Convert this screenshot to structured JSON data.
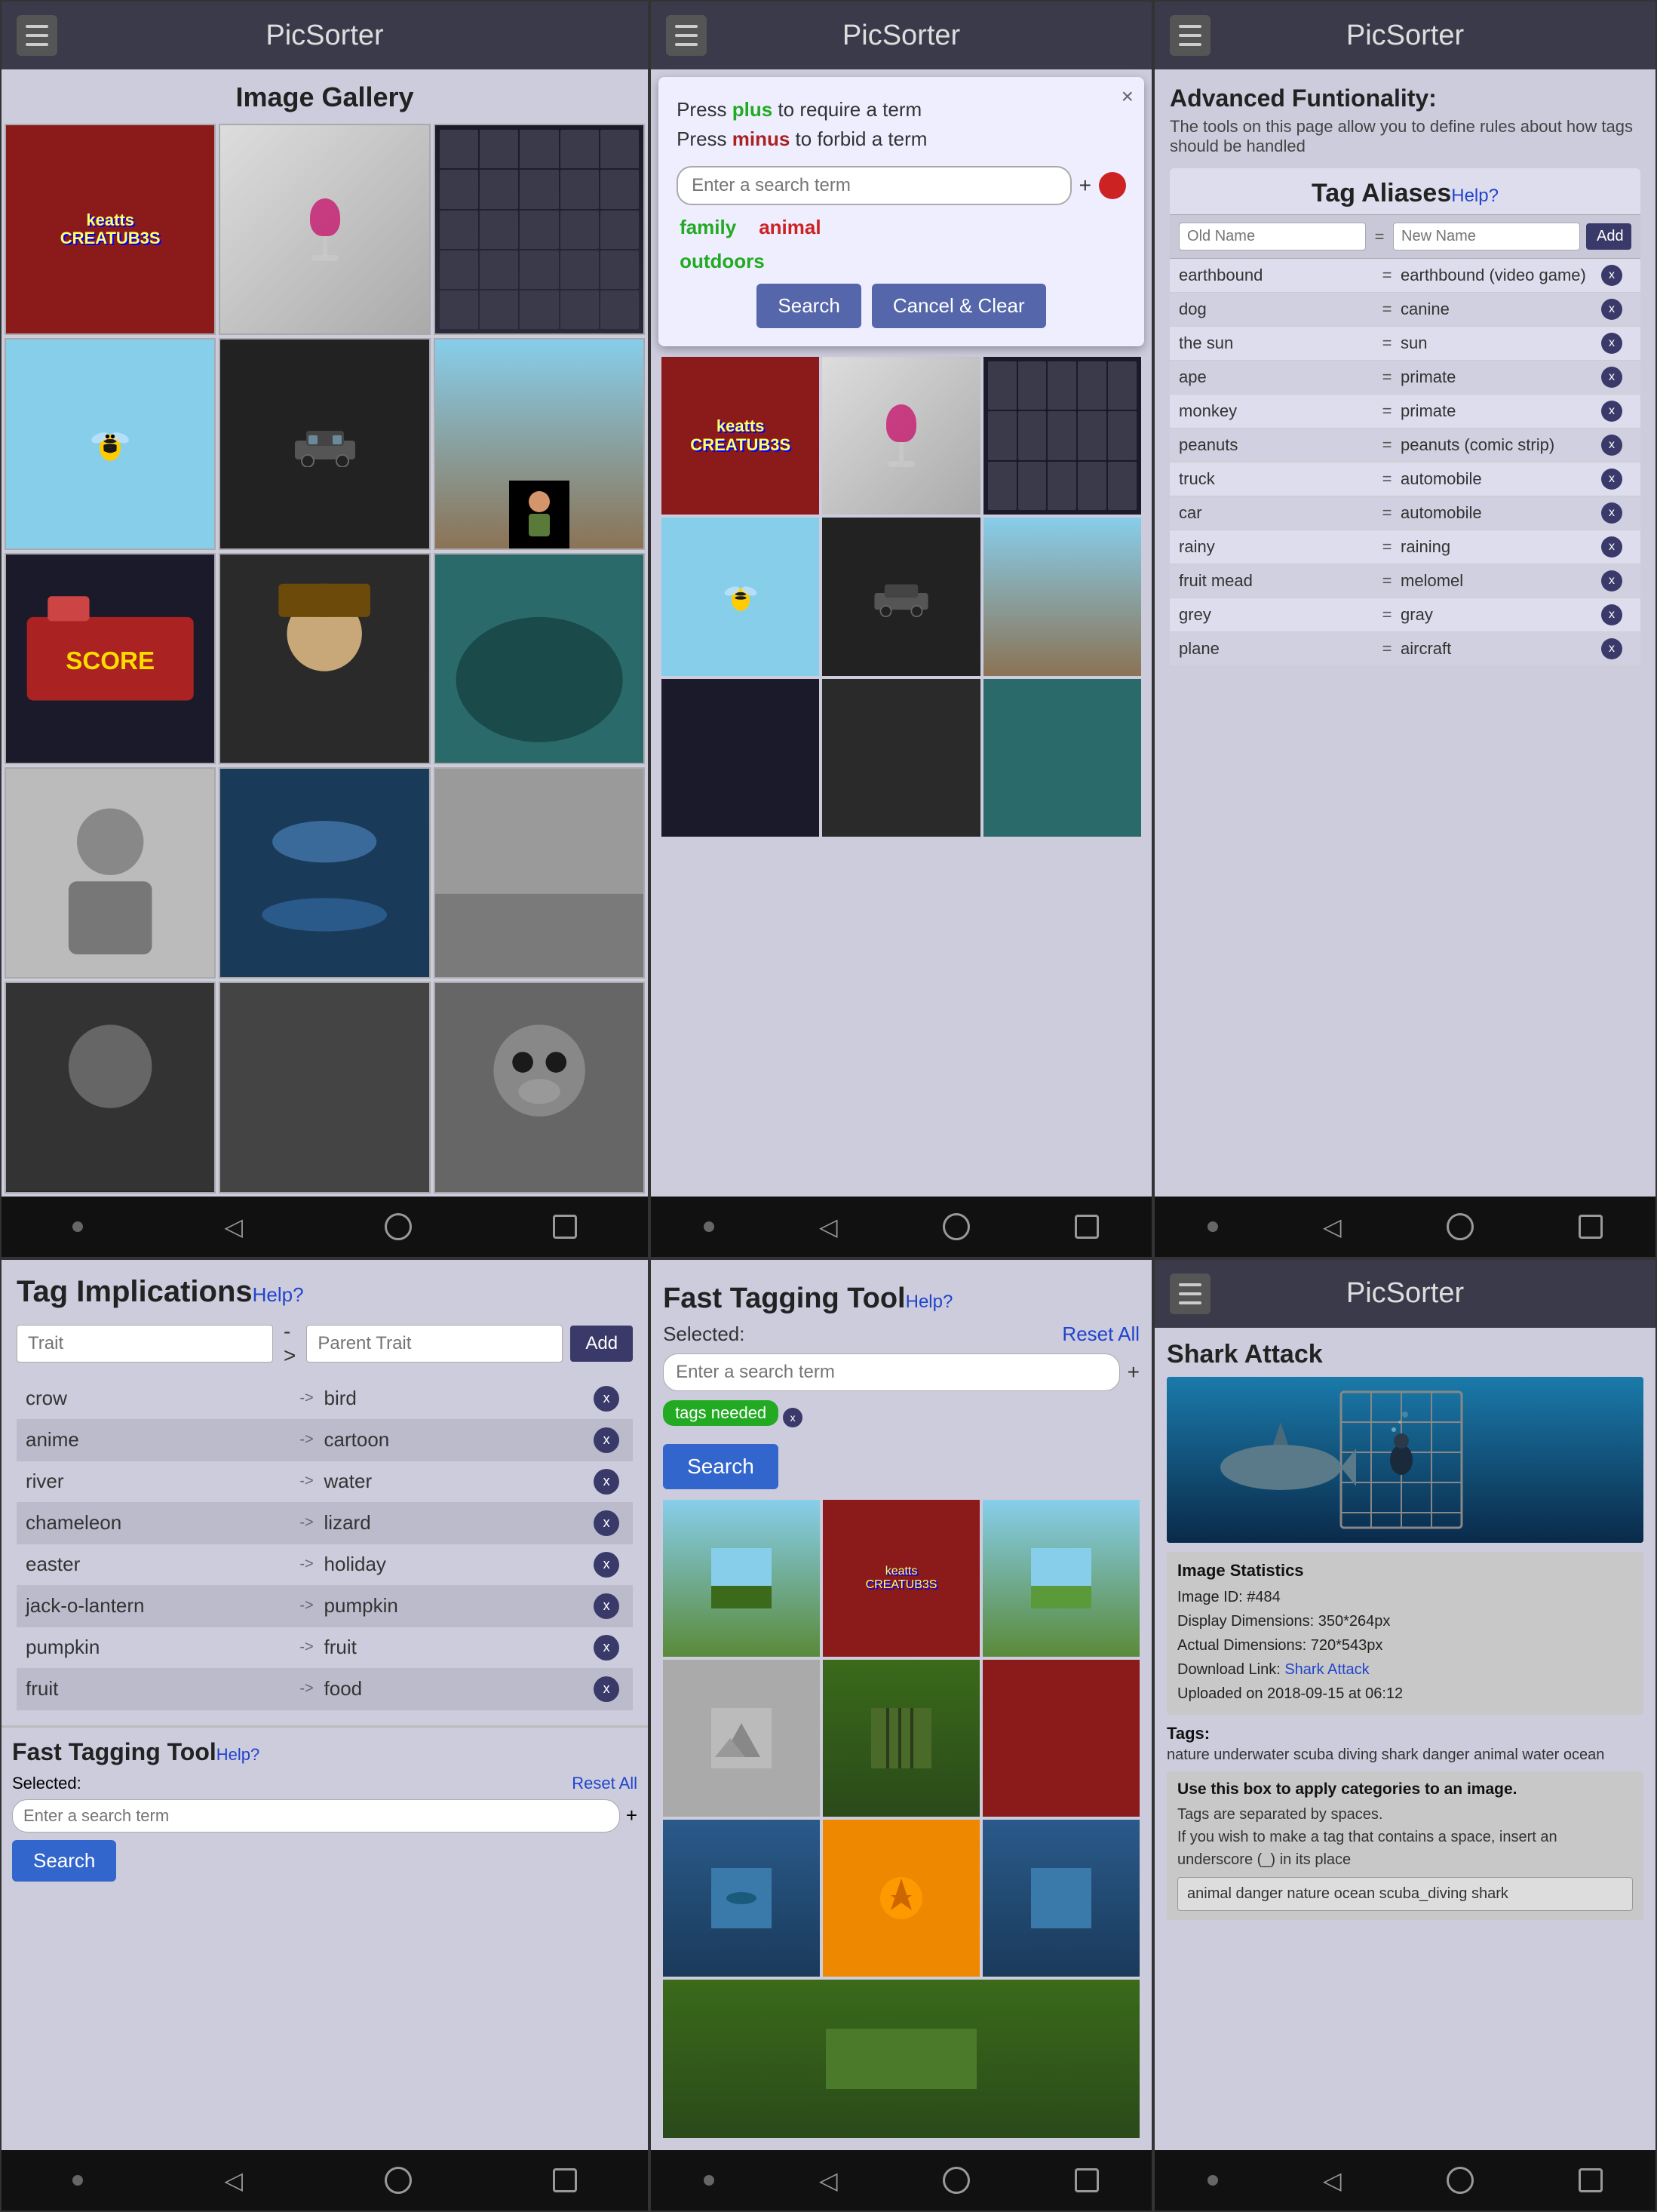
{
  "panels": {
    "panel1": {
      "header": {
        "title": "PicSorter"
      },
      "gallery": {
        "title": "Image Gallery",
        "images": [
          "creature",
          "wine",
          "keyboard",
          "bee",
          "car",
          "person-outdoor",
          "game",
          "man-hat",
          "teal",
          "oldman",
          "water-barrel",
          "crowd",
          "ghost",
          "pale2",
          "lemur"
        ]
      }
    },
    "panel2": {
      "header": {
        "title": "PicSorter"
      },
      "modal": {
        "instruction1": "Press plus to require a term",
        "instruction1_plus": "plus",
        "instruction2": "Press minus to forbid a term",
        "instruction2_minus": "minus",
        "input_placeholder": "Enter a search term",
        "tags": [
          "family",
          "outdoors",
          "animal"
        ],
        "tag_colors": [
          "green",
          "green",
          "red"
        ],
        "search_btn": "Search",
        "cancel_btn": "Cancel & Clear"
      }
    },
    "panel3": {
      "header": {
        "title": "PicSorter"
      },
      "advanced": {
        "title": "Advanced Funtionality:",
        "subtitle": "The tools on this page allow you to define rules about how tags should be handled",
        "aliases": {
          "title": "Tag Aliases",
          "help": "Help?",
          "col_old": "Old Name",
          "col_eq": "=",
          "col_new": "New Name",
          "add_btn": "Add",
          "rows": [
            {
              "old": "earthbound",
              "new": "earthbound (video game)"
            },
            {
              "old": "dog",
              "new": "canine"
            },
            {
              "old": "the sun",
              "new": "sun"
            },
            {
              "old": "ape",
              "new": "primate"
            },
            {
              "old": "monkey",
              "new": "primate"
            },
            {
              "old": "peanuts",
              "new": "peanuts (comic strip)"
            },
            {
              "old": "truck",
              "new": "automobile"
            },
            {
              "old": "car",
              "new": "automobile"
            },
            {
              "old": "rainy",
              "new": "raining"
            },
            {
              "old": "fruit mead",
              "new": "melomel"
            },
            {
              "old": "grey",
              "new": "gray"
            },
            {
              "old": "plane",
              "new": "aircraft"
            }
          ]
        }
      }
    },
    "panel4": {
      "implications": {
        "title": "Tag Implications",
        "help": "Help?",
        "input_trait": "Trait",
        "input_parent": "Parent Trait",
        "add_btn": "Add",
        "rows": [
          {
            "tag": "crow",
            "parent": "bird"
          },
          {
            "tag": "anime",
            "parent": "cartoon"
          },
          {
            "tag": "river",
            "parent": "water"
          },
          {
            "tag": "chameleon",
            "parent": "lizard"
          },
          {
            "tag": "easter",
            "parent": "holiday"
          },
          {
            "tag": "jack-o-lantern",
            "parent": "pumpkin"
          },
          {
            "tag": "pumpkin",
            "parent": "fruit"
          },
          {
            "tag": "fruit",
            "parent": "food"
          }
        ]
      },
      "fast_tag_small": {
        "title": "Fast Tagging Tool",
        "help": "Help?",
        "selected_label": "Selected:",
        "reset_all": "Reset All",
        "input_placeholder": "Enter a search term",
        "search_btn": "Search"
      }
    },
    "panel5": {
      "fast_tag": {
        "title": "Fast Tagging Tool",
        "help": "Help?",
        "selected_label": "Selected:",
        "reset_all": "Reset All",
        "input_placeholder": "Enter a search term",
        "tags_needed_badge": "tags needed",
        "search_btn": "Search"
      }
    },
    "panel6": {
      "header": {
        "title": "PicSorter"
      },
      "image_title": "Shark Attack",
      "stats": {
        "title": "Image Statistics",
        "id": "Image ID: #484",
        "display_dim": "Display Dimensions: 350*264px",
        "actual_dim": "Actual Dimensions: 720*543px",
        "download": "Download Link:",
        "download_link": "Shark Attack",
        "uploaded": "Uploaded on 2018-09-15 at 06:12"
      },
      "tags_label": "Tags:",
      "tags_value": "nature underwater scuba diving shark danger animal water ocean",
      "apply_box": {
        "title": "Use this box to apply categories to an image.",
        "desc1": "Tags are separated by spaces.",
        "desc2": "If you wish to make a tag that contains a space, insert an underscore (_) in its place",
        "input_value": "animal danger nature ocean scuba_diving shark"
      }
    }
  },
  "nav": {
    "back": "◁",
    "dot": "•"
  }
}
